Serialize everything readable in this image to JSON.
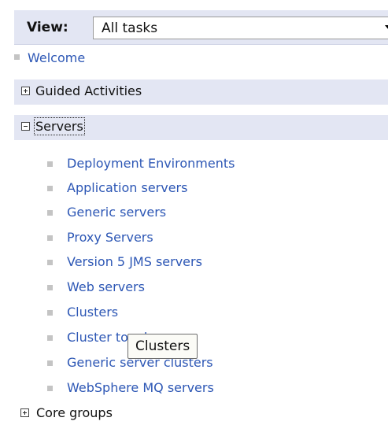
{
  "view": {
    "label": "View:",
    "selected": "All tasks"
  },
  "welcome": {
    "label": "Welcome"
  },
  "guided_activities": {
    "expander": "+",
    "label": "Guided Activities"
  },
  "servers": {
    "expander": "-",
    "label": "Servers",
    "items": [
      "Deployment Environments",
      "Application servers",
      "Generic servers",
      "Proxy Servers",
      "Version 5 JMS servers",
      "Web servers",
      "Clusters",
      "Cluster topology",
      "Generic server clusters",
      "WebSphere MQ servers"
    ]
  },
  "core_groups": {
    "expander": "+",
    "label": "Core groups"
  },
  "tooltip": {
    "text": "Clusters"
  }
}
